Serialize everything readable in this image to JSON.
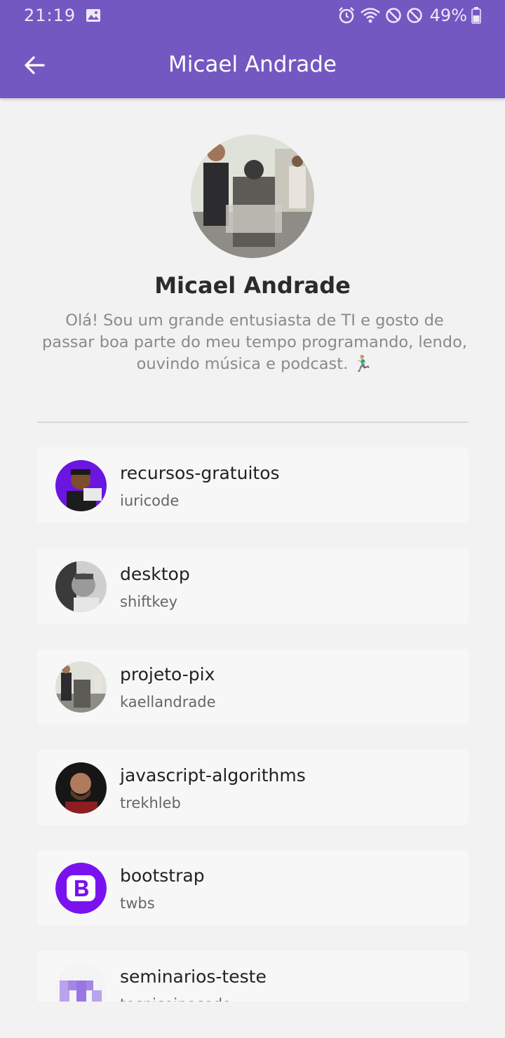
{
  "status_bar": {
    "time": "21:19",
    "battery": "49%",
    "icons": [
      "image-icon",
      "alarm-icon",
      "wifi-icon",
      "do-not-disturb-icon",
      "block-icon",
      "battery-icon"
    ]
  },
  "app_bar": {
    "title": "Micael Andrade",
    "back_icon": "arrow-back-icon",
    "color": "#7358c2"
  },
  "profile": {
    "name": "Micael Andrade",
    "bio": "Olá! Sou um grande entusiasta de TI e gosto de passar boa parte do meu tempo programando, lendo, ouvindo música e podcast. 🏃🏼‍♂️"
  },
  "repos": [
    {
      "name": "recursos-gratuitos",
      "owner": "iuricode"
    },
    {
      "name": "desktop",
      "owner": "shiftkey"
    },
    {
      "name": "projeto-pix",
      "owner": "kaellandrade"
    },
    {
      "name": "javascript-algorithms",
      "owner": "trekhleb"
    },
    {
      "name": "bootstrap",
      "owner": "twbs"
    },
    {
      "name": "seminarios-teste",
      "owner": "tecnicoinecodo"
    }
  ]
}
